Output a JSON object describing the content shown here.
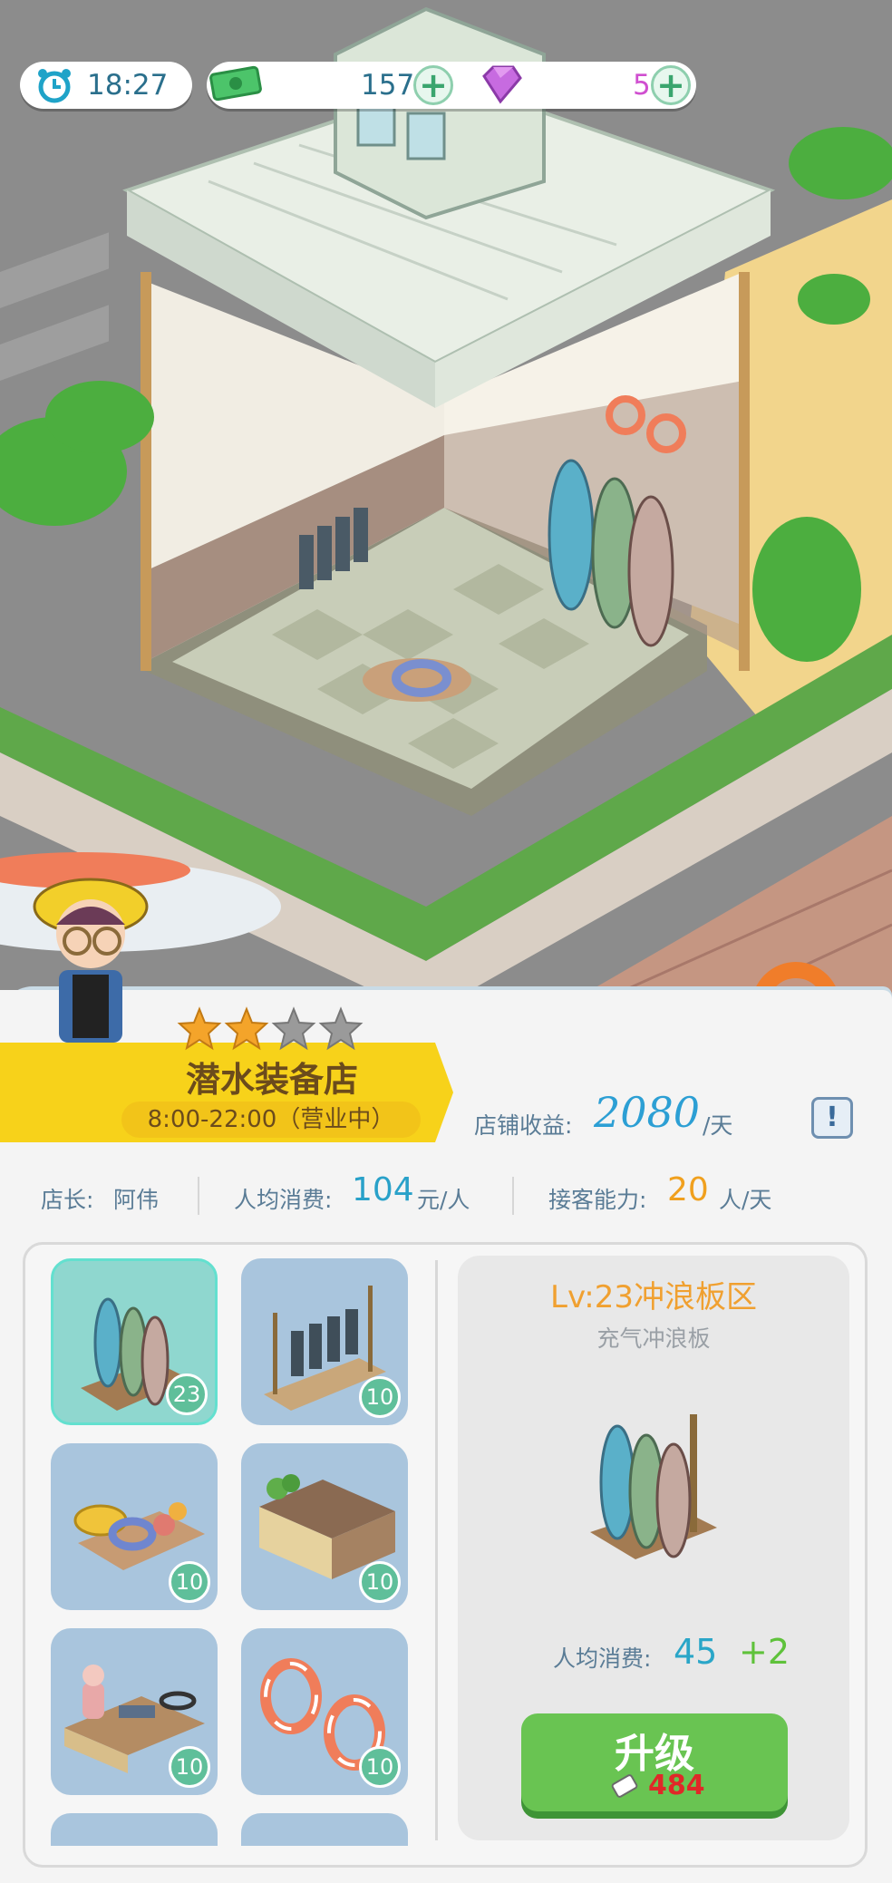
{
  "hud": {
    "time": "18:27",
    "money": "157",
    "gems": "5",
    "icons": [
      "alarm-clock-icon",
      "cash-icon",
      "gem-icon",
      "plus-icon"
    ]
  },
  "shop": {
    "name": "潜水装备店",
    "hours": "8:00-22:00（营业中）",
    "stars_filled": 2,
    "stars_total": 4,
    "income_label": "店铺收益:",
    "income_value": "2080",
    "income_unit": "/天",
    "info_label": "!",
    "manager_label": "店长:",
    "manager_name": "阿伟",
    "avg_spend_label": "人均消费:",
    "avg_spend_value": "104",
    "avg_spend_unit": "元/人",
    "capacity_label": "接客能力:",
    "capacity_value": "20",
    "capacity_unit": "人/天"
  },
  "items": [
    {
      "name": "surfboard-rack",
      "level": "23",
      "selected": true
    },
    {
      "name": "wetsuit-rack",
      "level": "10",
      "selected": false
    },
    {
      "name": "float-ring-table",
      "level": "10",
      "selected": false
    },
    {
      "name": "counter",
      "level": "10",
      "selected": false
    },
    {
      "name": "gear-table",
      "level": "10",
      "selected": false
    },
    {
      "name": "lifebuoys",
      "level": "10",
      "selected": false
    }
  ],
  "detail": {
    "title": "Lv:23冲浪板区",
    "subtitle": "充气冲浪板",
    "spend_label": "人均消费:",
    "spend_value": "45",
    "spend_bonus": "+2",
    "upgrade_label": "升级",
    "upgrade_cost": "484"
  },
  "colors": {
    "banner": "#f7d21a",
    "accent_blue": "#29a1c9",
    "accent_orange": "#f0a01e",
    "upgrade_green": "#69c452"
  }
}
